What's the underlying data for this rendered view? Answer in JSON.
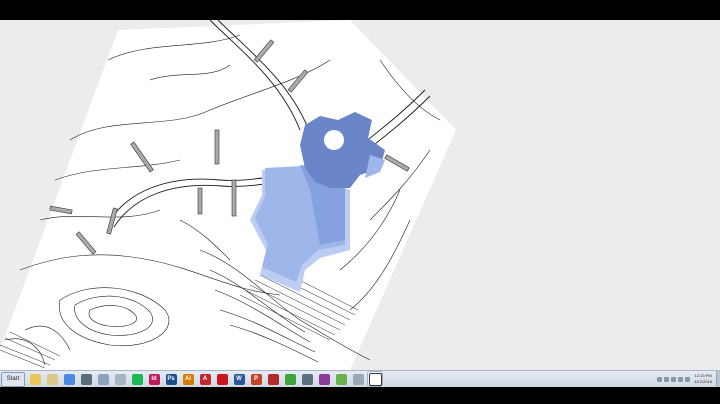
{
  "taskbar": {
    "start_label": "Start",
    "apps": [
      {
        "name": "start-folder-icon",
        "label": "",
        "color": "#e8c45a",
        "active": false
      },
      {
        "name": "notes-icon",
        "label": "",
        "color": "#d9c98a",
        "active": false
      },
      {
        "name": "chrome-icon",
        "label": "",
        "color": "#4a8be0",
        "active": false
      },
      {
        "name": "printer-icon",
        "label": "",
        "color": "#5a6b7a",
        "active": false
      },
      {
        "name": "files-icon",
        "label": "",
        "color": "#8da2be",
        "active": false
      },
      {
        "name": "disk-icon",
        "label": "",
        "color": "#a8b4c2",
        "active": false
      },
      {
        "name": "spotify-icon",
        "label": "",
        "color": "#1db954",
        "active": false
      },
      {
        "name": "indesign-icon",
        "label": "Id",
        "color": "#c2185b",
        "active": false
      },
      {
        "name": "photoshop-icon",
        "label": "Ps",
        "color": "#1a4f8a",
        "active": false
      },
      {
        "name": "illustrator-icon",
        "label": "Ai",
        "color": "#d97a00",
        "active": false
      },
      {
        "name": "autocad-icon",
        "label": "A",
        "color": "#c0282d",
        "active": false
      },
      {
        "name": "acrobat-icon",
        "label": "",
        "color": "#c8171d",
        "active": false
      },
      {
        "name": "word-icon",
        "label": "W",
        "color": "#2b579a",
        "active": false
      },
      {
        "name": "powerpoint-icon",
        "label": "P",
        "color": "#c4432b",
        "active": false
      },
      {
        "name": "revit-icon",
        "label": "",
        "color": "#b22a2a",
        "active": false
      },
      {
        "name": "grasshopper-icon",
        "label": "",
        "color": "#3fa33f",
        "active": false
      },
      {
        "name": "rhino-icon",
        "label": "",
        "color": "#5e6e7e",
        "active": false
      },
      {
        "name": "sketchup-icon",
        "label": "",
        "color": "#8a3a9a",
        "active": false
      },
      {
        "name": "evernote-icon",
        "label": "",
        "color": "#6ab04c",
        "active": false
      },
      {
        "name": "magnifier-icon",
        "label": "",
        "color": "#9aa8b8",
        "active": false
      },
      {
        "name": "screen-recorder-icon",
        "label": "",
        "color": "#ffffff",
        "active": true
      }
    ],
    "clock_time": "12:23 PM",
    "clock_date": "4/12/2016"
  },
  "colors": {
    "desktop": "#ececec",
    "building_dark": "#6a85c8",
    "building_light": "#9fb6ea",
    "building_pale": "#bccdf3",
    "contour": "#1a1a1a"
  }
}
